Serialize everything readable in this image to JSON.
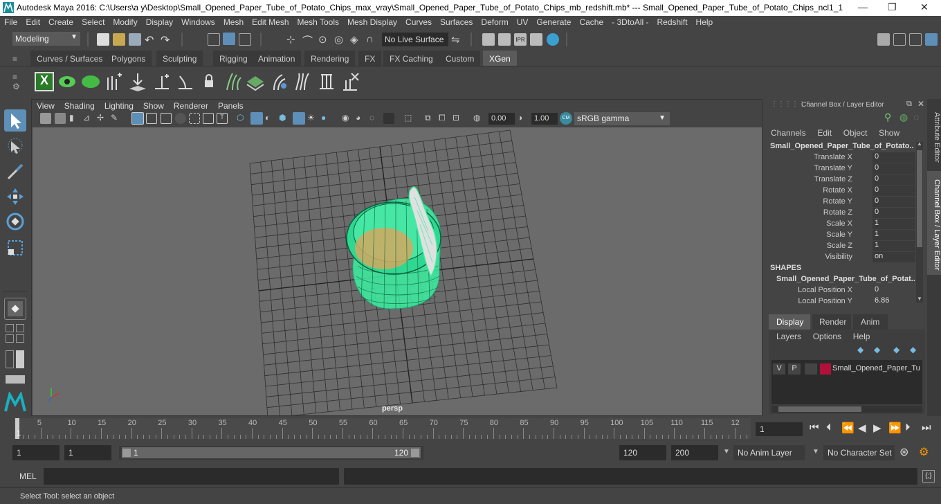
{
  "title_bar": {
    "title": "Autodesk Maya 2016: C:\\Users\\a y\\Desktop\\Small_Opened_Paper_Tube_of_Potato_Chips_max_vray\\Small_Opened_Paper_Tube_of_Potato_Chips_mb_redshift.mb*   ---   Small_Opened_Paper_Tube_of_Potato_Chips_ncl1_1",
    "minimize": "—",
    "maximize": "❐",
    "close": "✕"
  },
  "menu": [
    "File",
    "Edit",
    "Create",
    "Select",
    "Modify",
    "Display",
    "Windows",
    "Mesh",
    "Edit Mesh",
    "Mesh Tools",
    "Mesh Display",
    "Curves",
    "Surfaces",
    "Deform",
    "UV",
    "Generate",
    "Cache",
    "- 3DtoAll -",
    "Redshift",
    "Help"
  ],
  "status_line": {
    "mode": "Modeling",
    "live_surface": "No Live Surface"
  },
  "shelf_tabs": [
    {
      "label": "Curves / Surfaces",
      "active": false
    },
    {
      "label": "Polygons",
      "active": false
    },
    {
      "label": "Sculpting",
      "active": false
    },
    {
      "label": "Rigging",
      "active": false
    },
    {
      "label": "Animation",
      "active": false
    },
    {
      "label": "Rendering",
      "active": false
    },
    {
      "label": "FX",
      "active": false
    },
    {
      "label": "FX Caching",
      "active": false
    },
    {
      "label": "Custom",
      "active": false
    },
    {
      "label": "XGen",
      "active": true
    }
  ],
  "viewport": {
    "menu": [
      "View",
      "Shading",
      "Lighting",
      "Show",
      "Renderer",
      "Panels"
    ],
    "exposure": "0.00",
    "gamma": "1.00",
    "color_space": "sRGB gamma",
    "camera_label": "persp"
  },
  "channel_box": {
    "header": "Channel Box / Layer Editor",
    "menu": [
      "Channels",
      "Edit",
      "Object",
      "Show"
    ],
    "object_name": "Small_Opened_Paper_Tube_of_Potato...",
    "attributes": [
      {
        "label": "Translate X",
        "value": "0"
      },
      {
        "label": "Translate Y",
        "value": "0"
      },
      {
        "label": "Translate Z",
        "value": "0"
      },
      {
        "label": "Rotate X",
        "value": "0"
      },
      {
        "label": "Rotate Y",
        "value": "0"
      },
      {
        "label": "Rotate Z",
        "value": "0"
      },
      {
        "label": "Scale X",
        "value": "1"
      },
      {
        "label": "Scale Y",
        "value": "1"
      },
      {
        "label": "Scale Z",
        "value": "1"
      },
      {
        "label": "Visibility",
        "value": "on"
      }
    ],
    "shapes_label": "SHAPES",
    "shape_name": "Small_Opened_Paper_Tube_of_Potat...",
    "shape_attributes": [
      {
        "label": "Local Position X",
        "value": "0"
      },
      {
        "label": "Local Position Y",
        "value": "6.86"
      }
    ]
  },
  "layer_editor": {
    "tabs": [
      {
        "label": "Display",
        "active": true
      },
      {
        "label": "Render",
        "active": false
      },
      {
        "label": "Anim",
        "active": false
      }
    ],
    "menu": [
      "Layers",
      "Options",
      "Help"
    ],
    "layer": {
      "v": "V",
      "p": "P",
      "name": "Small_Opened_Paper_Tu",
      "color": "#b0103a"
    }
  },
  "side_tabs": [
    "Attribute Editor",
    "Channel Box / Layer Editor"
  ],
  "timeline": {
    "ticks": [
      "5",
      "10",
      "15",
      "20",
      "25",
      "30",
      "35",
      "40",
      "45",
      "50",
      "55",
      "60",
      "65",
      "70",
      "75",
      "80",
      "85",
      "90",
      "95",
      "100",
      "105",
      "110",
      "115",
      "12"
    ],
    "start_marker": "1",
    "current_frame": "1"
  },
  "range": {
    "start": "1",
    "playback_start": "1",
    "slider_start": "1",
    "slider_end": "120",
    "playback_end": "120",
    "end": "200",
    "anim_layer": "No Anim Layer",
    "character_set": "No Character Set"
  },
  "command_line": {
    "label": "MEL"
  },
  "help_line": {
    "text": "Select Tool: select an object"
  },
  "colors": {
    "wire_green": "#3cf0a0",
    "accent_blue": "#5e8fb8",
    "grid_line": "#2e2e2e",
    "viewport_bg": "#6b6b6b"
  }
}
